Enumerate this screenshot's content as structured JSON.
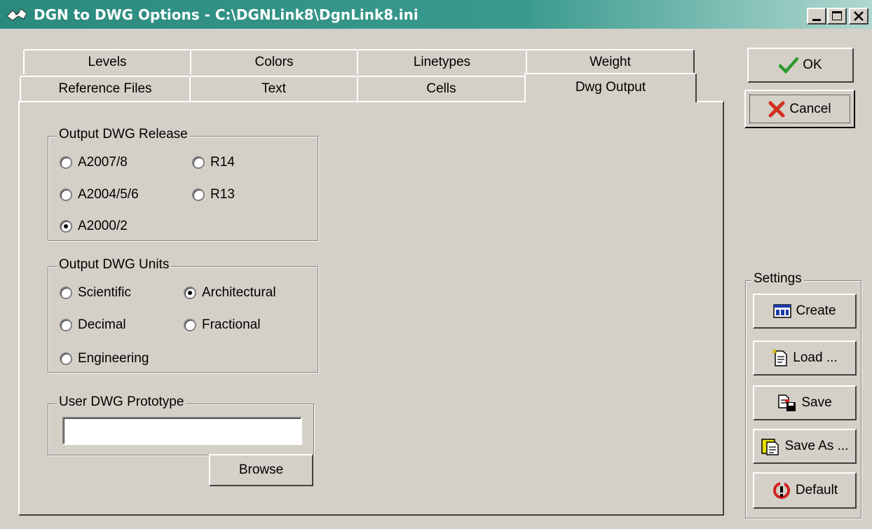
{
  "window": {
    "title": "DGN to DWG Options - C:\\DGNLink8\\DgnLink8.ini",
    "controls": [
      "minimize",
      "maximize",
      "close"
    ]
  },
  "tabs": {
    "row1": [
      "Levels",
      "Colors",
      "Linetypes",
      "Weight"
    ],
    "row2": [
      "Reference Files",
      "Text",
      "Cells",
      "Dwg Output"
    ],
    "active": "Dwg Output"
  },
  "release_group": {
    "label": "Output DWG Release",
    "options": [
      {
        "label": "A2007/8",
        "checked": false
      },
      {
        "label": "R14",
        "checked": false
      },
      {
        "label": "A2004/5/6",
        "checked": false
      },
      {
        "label": "R13",
        "checked": false
      },
      {
        "label": "A2000/2",
        "checked": true
      }
    ]
  },
  "units_group": {
    "label": "Output DWG Units",
    "options": [
      {
        "label": "Scientific",
        "checked": false
      },
      {
        "label": "Architectural",
        "checked": true
      },
      {
        "label": "Decimal",
        "checked": false
      },
      {
        "label": "Fractional",
        "checked": false
      },
      {
        "label": "Engineering",
        "checked": false
      }
    ]
  },
  "prototype_group": {
    "label": "User DWG Prototype",
    "value": "",
    "browse_label": "Browse"
  },
  "buttons": {
    "ok": "OK",
    "cancel": "Cancel"
  },
  "settings": {
    "label": "Settings",
    "create": "Create",
    "load": "Load ...",
    "save": "Save",
    "save_as": "Save As ...",
    "default": "Default"
  },
  "colors": {
    "titlebar": "#2a8a7e",
    "face": "#d4d0c8",
    "ok_check": "#2e9b2e",
    "cancel_x": "#d03020",
    "default_icon": "#d02020"
  }
}
